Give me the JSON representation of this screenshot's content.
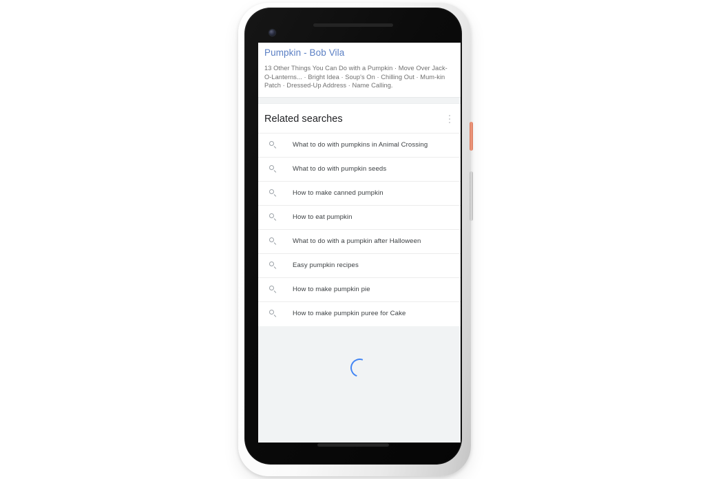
{
  "device": {
    "name": "google-pixel-phone",
    "frame_color": "#e9e9e9",
    "body_color": "#0d0d0d",
    "power_button_color": "#e8836b",
    "volume_button_color": "#cccccc"
  },
  "screen": {
    "background_color": "#f1f3f4",
    "snippet": {
      "title": "Pumpkin - Bob Vila",
      "title_color": "#5a7fc4",
      "description": "13 Other Things You Can Do with a Pumpkin · Move Over Jack-O-Lanterns... · Bright Idea · Soup's On · Chilling Out · Mum-kin Patch · Dressed-Up Address · Name Calling."
    },
    "related_searches": {
      "title": "Related searches",
      "menu_icon": "kebab-menu-icon",
      "items": [
        {
          "icon": "search-icon",
          "label": "What to do with pumpkins in Animal Crossing"
        },
        {
          "icon": "search-icon",
          "label": "What to do with pumpkin seeds"
        },
        {
          "icon": "search-icon",
          "label": "How to make canned pumpkin"
        },
        {
          "icon": "search-icon",
          "label": "How to eat pumpkin"
        },
        {
          "icon": "search-icon",
          "label": "What to do with a pumpkin after Halloween"
        },
        {
          "icon": "search-icon",
          "label": "Easy pumpkin recipes"
        },
        {
          "icon": "search-icon",
          "label": "How to make pumpkin pie"
        },
        {
          "icon": "search-icon",
          "label": "How to make pumpkin puree for Cake"
        }
      ]
    },
    "loading": {
      "icon": "loading-spinner-icon",
      "spinner_color": "#4285f4"
    }
  }
}
